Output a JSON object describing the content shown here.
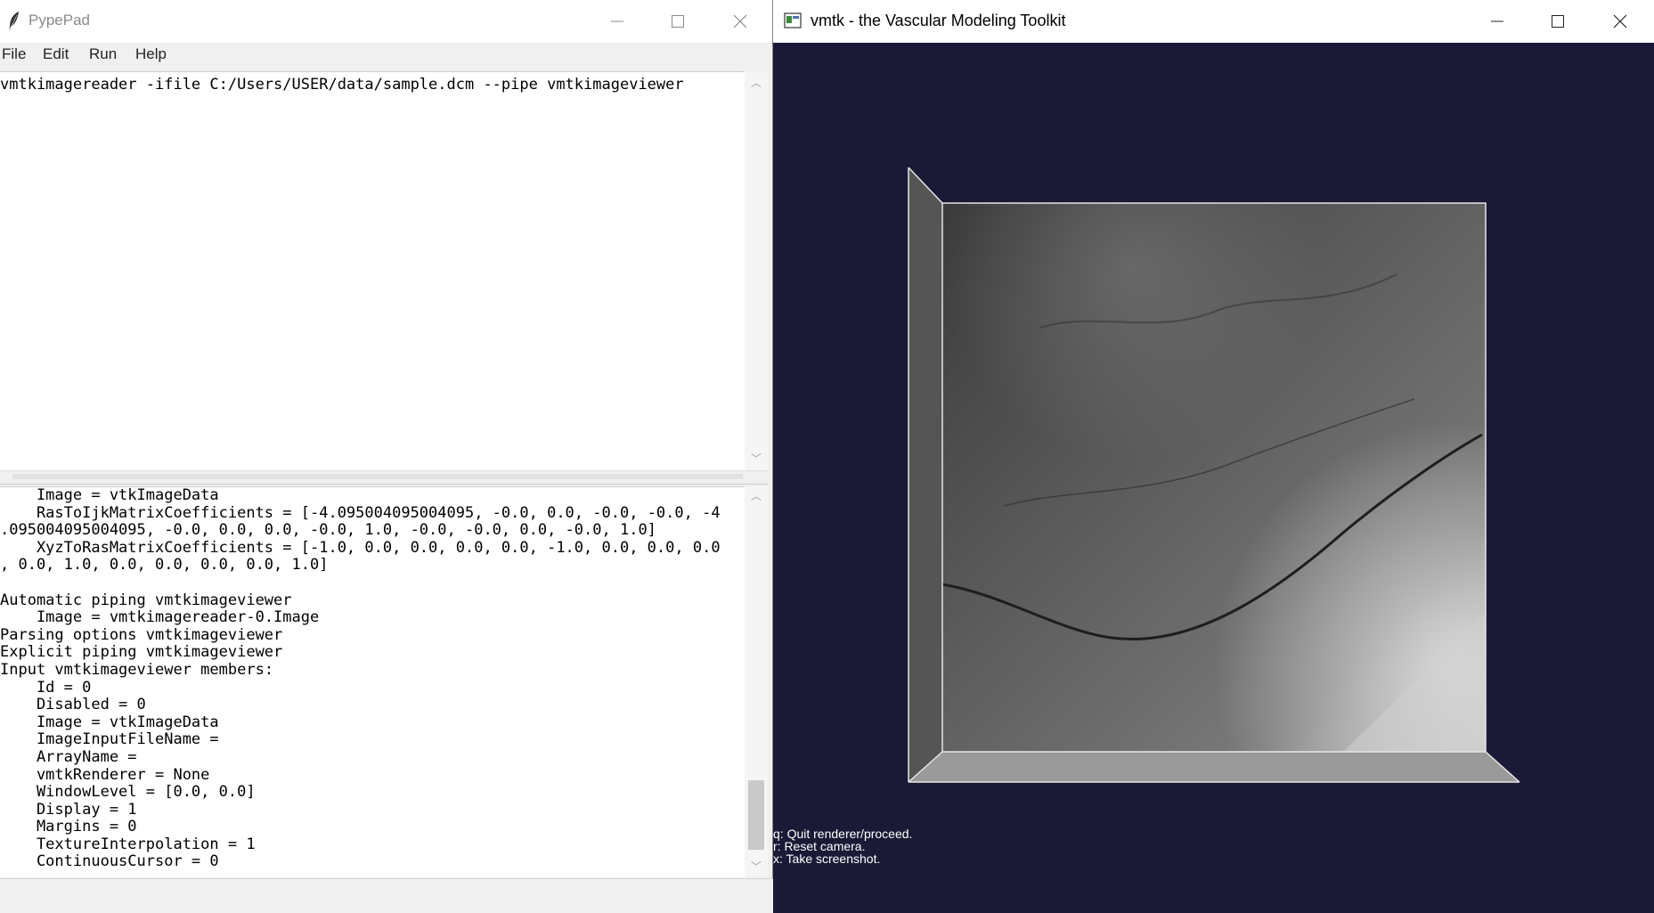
{
  "pypepad": {
    "title": "PypePad",
    "menu": [
      "File",
      "Edit",
      "Run",
      "Help"
    ],
    "editor_text": "vmtkimagereader -ifile C:/Users/USER/data/sample.dcm --pipe vmtkimageviewer",
    "console_lines": [
      "    Image = vtkImageData",
      "    RasToIjkMatrixCoefficients = [-4.095004095004095, -0.0, 0.0, -0.0, -0.0, -4",
      ".095004095004095, -0.0, 0.0, 0.0, -0.0, 1.0, -0.0, -0.0, 0.0, -0.0, 1.0]",
      "    XyzToRasMatrixCoefficients = [-1.0, 0.0, 0.0, 0.0, 0.0, -1.0, 0.0, 0.0, 0.0",
      ", 0.0, 1.0, 0.0, 0.0, 0.0, 0.0, 1.0]",
      "",
      "Automatic piping vmtkimageviewer",
      "    Image = vmtkimagereader-0.Image",
      "Parsing options vmtkimageviewer",
      "Explicit piping vmtkimageviewer",
      "Input vmtkimageviewer members:",
      "    Id = 0",
      "    Disabled = 0",
      "    Image = vtkImageData",
      "    ImageInputFileName =",
      "    ArrayName =",
      "    vmtkRenderer = None",
      "    WindowLevel = [0.0, 0.0]",
      "    Display = 1",
      "    Margins = 0",
      "    TextureInterpolation = 1",
      "    ContinuousCursor = 0"
    ],
    "icons": {
      "app": "feather-icon",
      "minimize": "minimize-icon",
      "maximize": "maximize-icon",
      "close": "close-icon"
    }
  },
  "vmtk": {
    "title": "vmtk - the Vascular Modeling Toolkit",
    "hints": [
      "q: Quit renderer/proceed.",
      "r: Reset camera.",
      "x: Take screenshot."
    ],
    "colors": {
      "background": "#1a1a36",
      "frame": "#e6e6e6"
    }
  }
}
